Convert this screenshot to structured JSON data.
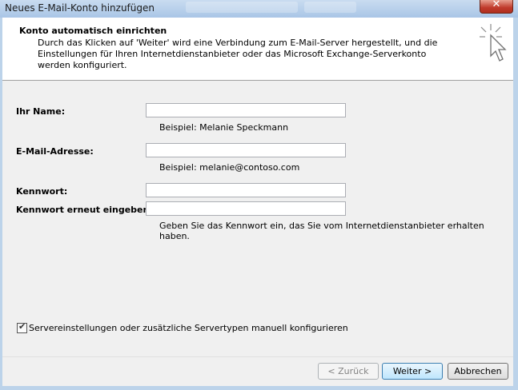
{
  "window": {
    "title": "Neues E-Mail-Konto hinzufügen",
    "close_label": "✕"
  },
  "header": {
    "title": "Konto automatisch einrichten",
    "description": "Durch das Klicken auf 'Weiter' wird eine Verbindung zum E-Mail-Server hergestellt, und die Einstellungen für Ihren Internetdienstanbieter oder das Microsoft Exchange-Serverkonto werden konfiguriert."
  },
  "form": {
    "name_label": "Ihr Name:",
    "name_value": "",
    "name_hint": "Beispiel: Melanie Speckmann",
    "email_label": "E-Mail-Adresse:",
    "email_value": "",
    "email_hint": "Beispiel: melanie@contoso.com",
    "password_label": "Kennwort:",
    "password_value": "",
    "password_repeat_label": "Kennwort erneut eingeben:",
    "password_repeat_value": "",
    "password_hint": "Geben Sie das Kennwort ein, das Sie vom Internetdienstanbieter erhalten haben.",
    "manual_config_label": "Servereinstellungen oder zusätzliche Servertypen manuell konfigurieren",
    "manual_config_checked": true
  },
  "buttons": {
    "back": "< Zurück",
    "next": "Weiter >",
    "cancel": "Abbrechen"
  }
}
